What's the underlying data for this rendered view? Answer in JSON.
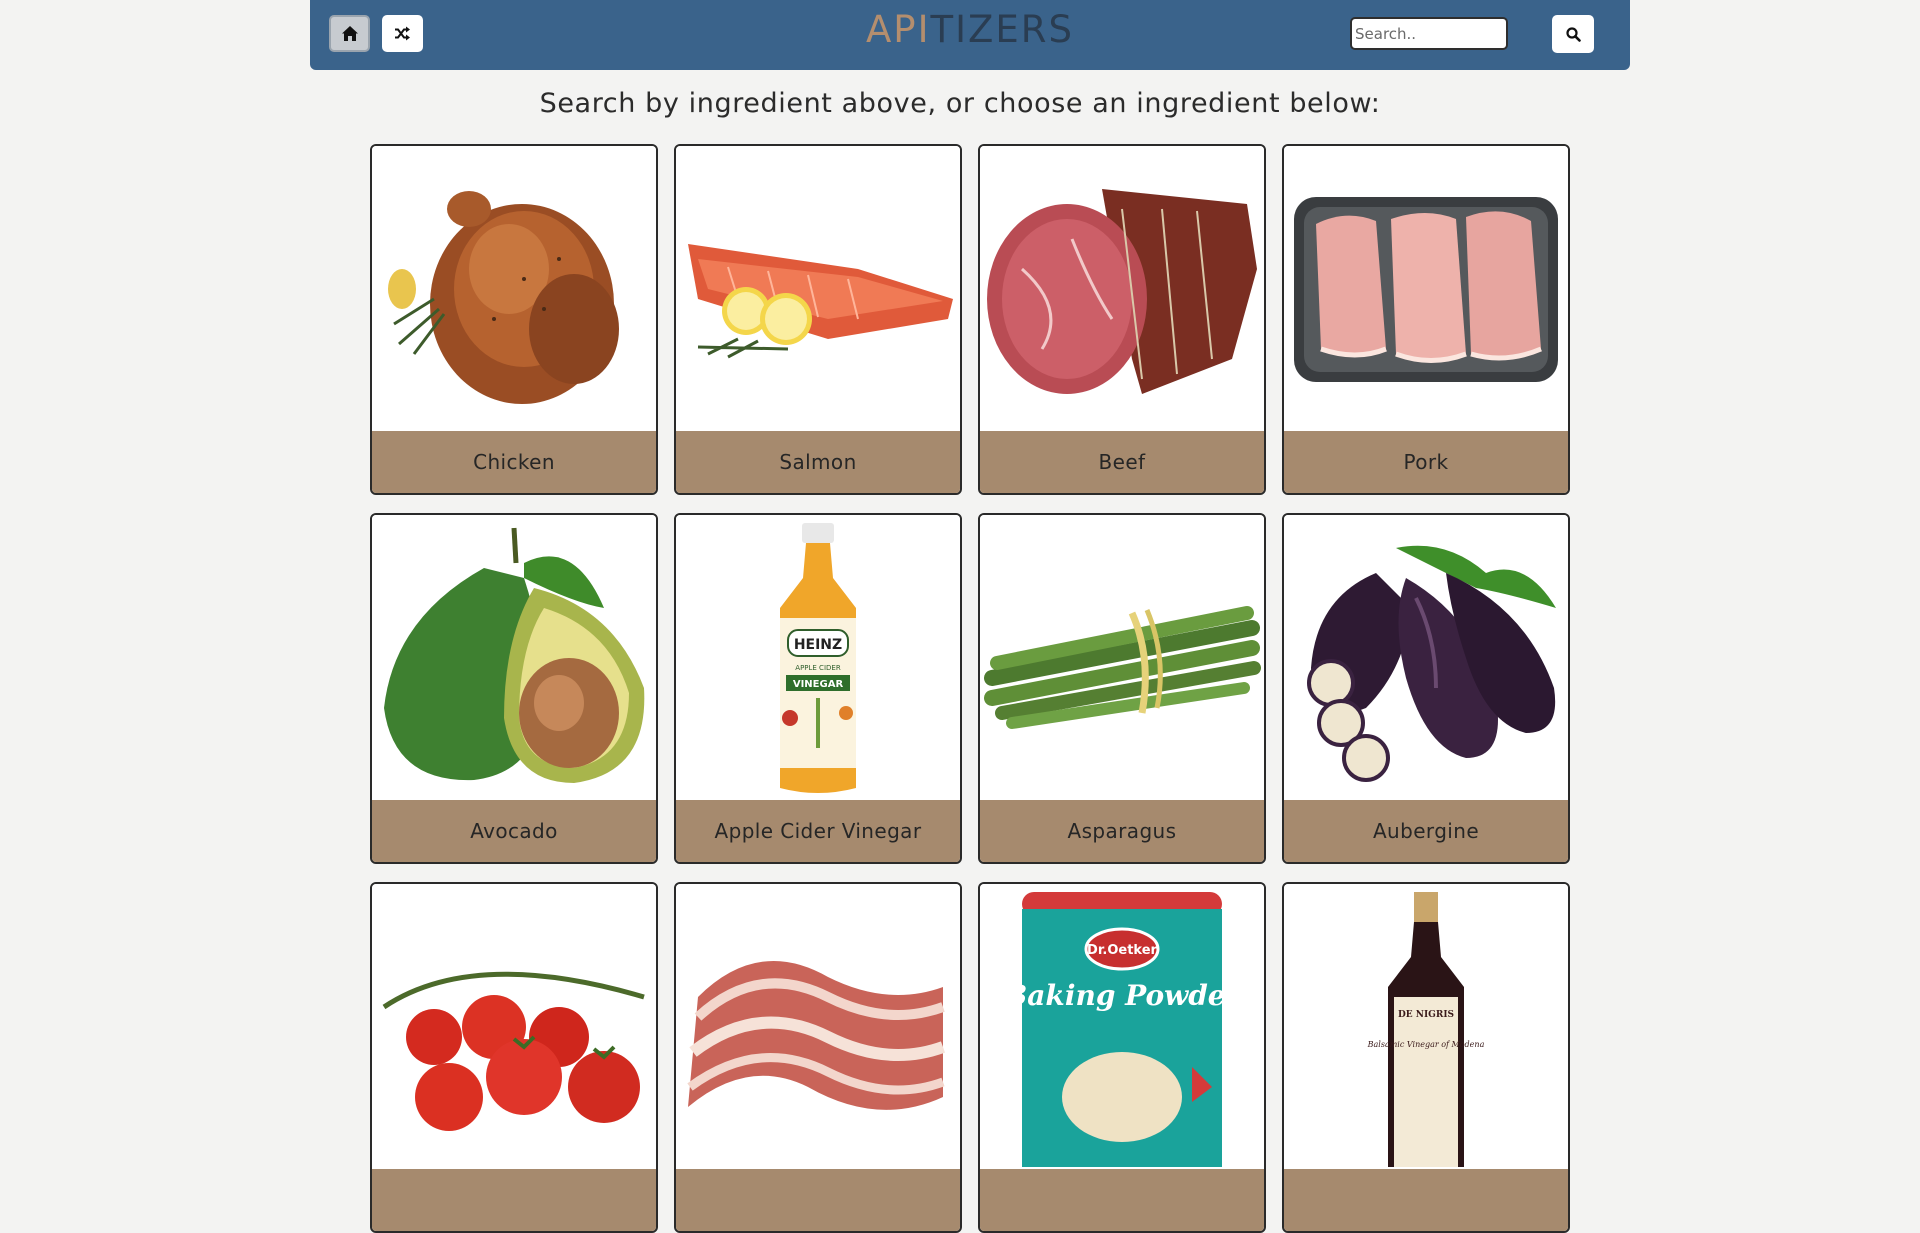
{
  "nav": {
    "brand_prefix": "API",
    "brand_suffix": "TIZERS",
    "home_icon": "home-icon",
    "random_icon": "shuffle-icon",
    "search_placeholder": "Search..",
    "search_value": "",
    "search_icon": "search-icon"
  },
  "subtitle": "Search by ingredient above, or choose an ingredient below:",
  "ingredients": [
    {
      "label": "Chicken",
      "image": "roast-chicken"
    },
    {
      "label": "Salmon",
      "image": "salmon-fillet"
    },
    {
      "label": "Beef",
      "image": "beef-joint"
    },
    {
      "label": "Pork",
      "image": "pork-chops"
    },
    {
      "label": "Avocado",
      "image": "avocado"
    },
    {
      "label": "Apple Cider Vinegar",
      "image": "vinegar-bottle"
    },
    {
      "label": "Asparagus",
      "image": "asparagus-bundle"
    },
    {
      "label": "Aubergine",
      "image": "aubergines"
    },
    {
      "label": "",
      "image": "vine-tomatoes"
    },
    {
      "label": "",
      "image": "bacon-rashers"
    },
    {
      "label": "",
      "image": "baking-powder-tub"
    },
    {
      "label": "",
      "image": "balsamic-vinegar-bottle"
    }
  ],
  "packaging_text": {
    "vinegar_brand": "HEINZ",
    "vinegar_product": "APPLE CIDER",
    "vinegar_name": "VINEGAR",
    "baking_brand": "Dr.Oetker",
    "baking_name": "Baking Powder",
    "balsamic_brand": "DE NIGRIS",
    "balsamic_name": "Balsamic Vinegar of Modena"
  },
  "colors": {
    "navbar": "#3a638b",
    "card_label_bg": "#a68a6e",
    "brand_accent": "#b48e6e",
    "page_bg": "#f3f3f2"
  }
}
